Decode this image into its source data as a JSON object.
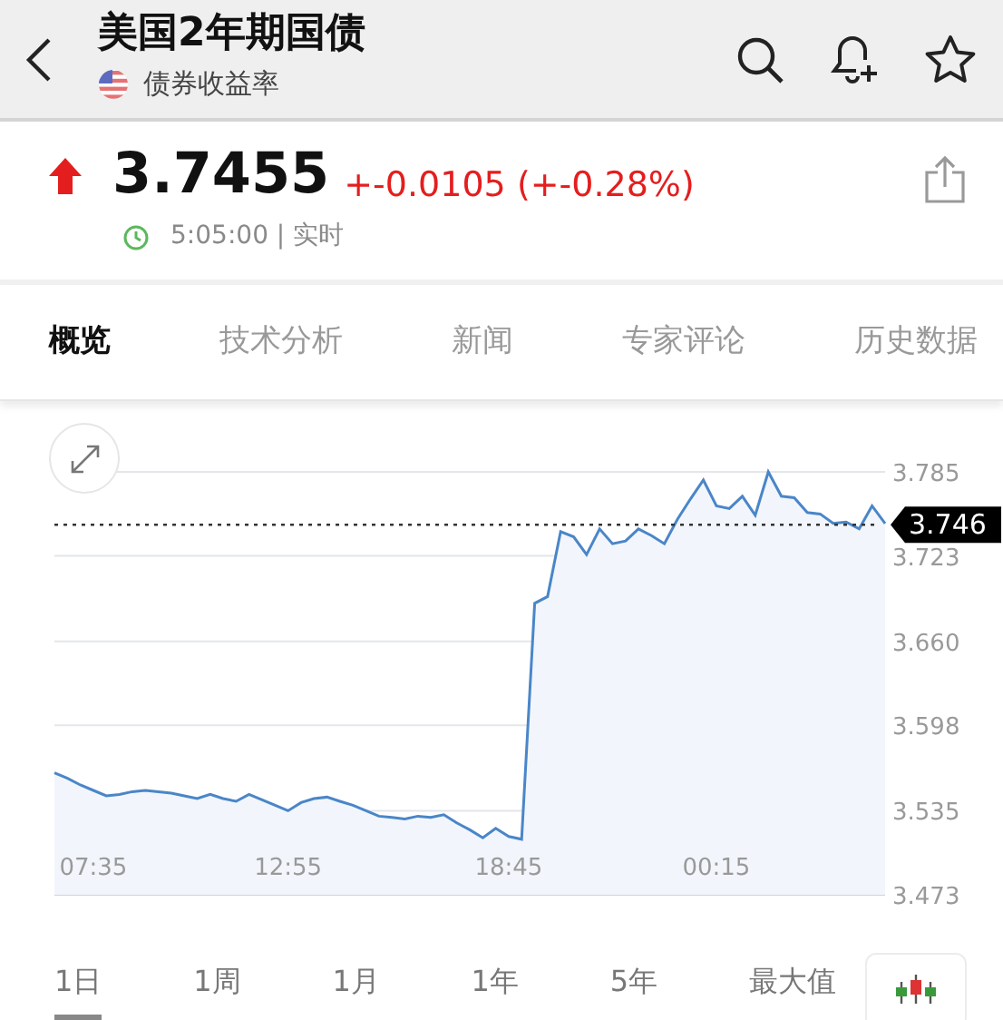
{
  "header": {
    "title": "美国2年期国债",
    "subtitle": "债券收益率"
  },
  "quote": {
    "price": "3.7455",
    "change": "+-0.0105 (+-0.28%)",
    "time": "5:05:00 | 实时"
  },
  "tabs": [
    {
      "label": "概览",
      "selected": true
    },
    {
      "label": "技术分析",
      "selected": false
    },
    {
      "label": "新闻",
      "selected": false
    },
    {
      "label": "专家评论",
      "selected": false
    },
    {
      "label": "历史数据",
      "selected": false
    }
  ],
  "chart": {
    "chart_data": {
      "type": "area",
      "grid": true,
      "categories": [
        null,
        null,
        null,
        "07:35",
        null,
        null,
        null,
        null,
        null,
        null,
        null,
        null,
        null,
        null,
        null,
        null,
        null,
        null,
        "12:55",
        null,
        null,
        null,
        null,
        null,
        null,
        null,
        null,
        null,
        null,
        null,
        null,
        null,
        null,
        null,
        null,
        "18:45",
        null,
        null,
        null,
        null,
        null,
        null,
        null,
        null,
        null,
        null,
        null,
        null,
        null,
        null,
        null,
        "00:15",
        null,
        null,
        null,
        null,
        null,
        null,
        null,
        null,
        null,
        null,
        null,
        null,
        null
      ],
      "series": [
        {
          "color": "#4a86c8",
          "values": [
            3.563,
            3.559,
            3.554,
            3.55,
            3.546,
            3.547,
            3.549,
            3.55,
            3.549,
            3.548,
            3.546,
            3.544,
            3.547,
            3.544,
            3.542,
            3.547,
            3.543,
            3.539,
            3.535,
            3.541,
            3.544,
            3.545,
            3.542,
            3.539,
            3.535,
            3.531,
            3.53,
            3.529,
            3.531,
            3.53,
            3.532,
            3.526,
            3.521,
            3.515,
            3.522,
            3.516,
            3.514,
            3.688,
            3.693,
            3.741,
            3.737,
            3.724,
            3.743,
            3.732,
            3.734,
            3.743,
            3.738,
            3.732,
            3.75,
            3.765,
            3.779,
            3.76,
            3.758,
            3.767,
            3.753,
            3.785,
            3.767,
            3.766,
            3.755,
            3.754,
            3.747,
            3.748,
            3.743,
            3.76,
            3.747
          ]
        }
      ],
      "ylim": [
        3.473,
        3.785
      ],
      "yticks": [
        {
          "value": 3.785,
          "label": "3.785"
        },
        {
          "value": 3.723,
          "label": "3.723"
        },
        {
          "value": 3.66,
          "label": "3.660"
        },
        {
          "value": 3.598,
          "label": "3.598"
        },
        {
          "value": 3.535,
          "label": "3.535"
        },
        {
          "value": 3.473,
          "label": "3.473"
        }
      ],
      "ref_lines": [
        {
          "axis": "y",
          "value": 3.746,
          "label": "3.746"
        }
      ]
    }
  },
  "ranges": [
    {
      "label": "1日",
      "selected": true
    },
    {
      "label": "1周",
      "selected": false
    },
    {
      "label": "1月",
      "selected": false
    },
    {
      "label": "1年",
      "selected": false
    },
    {
      "label": "5年",
      "selected": false
    },
    {
      "label": "最大值",
      "selected": false
    }
  ]
}
